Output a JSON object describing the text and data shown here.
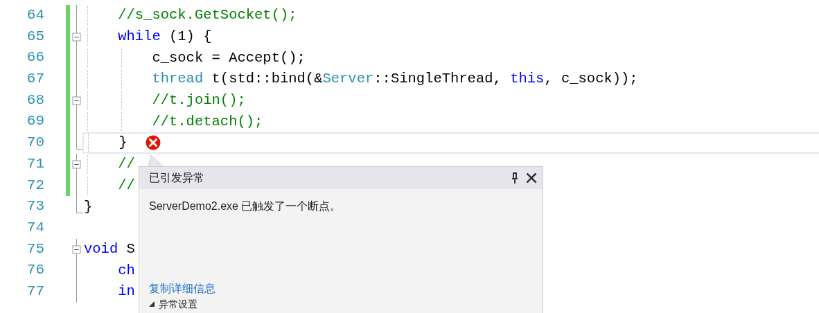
{
  "editor": {
    "lines": [
      {
        "number": "64",
        "kind": "body",
        "changed": true,
        "current": false,
        "error": false,
        "tokens": [
          {
            "kind": "comment",
            "text": "    //s_sock.GetSocket();"
          }
        ]
      },
      {
        "number": "65",
        "kind": "start",
        "changed": true,
        "current": false,
        "error": false,
        "tokens": [
          {
            "kind": "keyword",
            "text": "    while"
          },
          {
            "kind": "plain",
            "text": " (1) {"
          }
        ]
      },
      {
        "number": "66",
        "kind": "body",
        "changed": true,
        "current": false,
        "error": false,
        "tokens": [
          {
            "kind": "plain",
            "text": "        c_sock = Accept();"
          }
        ]
      },
      {
        "number": "67",
        "kind": "body",
        "changed": true,
        "current": false,
        "error": false,
        "tokens": [
          {
            "kind": "type",
            "text": "        thread"
          },
          {
            "kind": "plain",
            "text": " t(std::bind(&"
          },
          {
            "kind": "type",
            "text": "Server"
          },
          {
            "kind": "plain",
            "text": "::SingleThread, "
          },
          {
            "kind": "keyword",
            "text": "this"
          },
          {
            "kind": "plain",
            "text": ", c_sock));"
          }
        ]
      },
      {
        "number": "68",
        "kind": "start",
        "changed": true,
        "current": false,
        "error": false,
        "tokens": [
          {
            "kind": "comment",
            "text": "        //t.join();"
          }
        ]
      },
      {
        "number": "69",
        "kind": "body",
        "changed": true,
        "current": false,
        "error": false,
        "tokens": [
          {
            "kind": "comment",
            "text": "        //t.detach();"
          }
        ]
      },
      {
        "number": "70",
        "kind": "end",
        "changed": true,
        "current": true,
        "error": true,
        "tokens": [
          {
            "kind": "plain",
            "text": "    }"
          }
        ]
      },
      {
        "number": "71",
        "kind": "start",
        "changed": true,
        "current": false,
        "error": false,
        "tokens": [
          {
            "kind": "comment",
            "text": "    //"
          }
        ]
      },
      {
        "number": "72",
        "kind": "body",
        "changed": true,
        "current": false,
        "error": false,
        "tokens": [
          {
            "kind": "comment",
            "text": "    //"
          }
        ]
      },
      {
        "number": "73",
        "kind": "end",
        "changed": false,
        "current": false,
        "error": false,
        "tokens": [
          {
            "kind": "plain",
            "text": "}"
          }
        ]
      },
      {
        "number": "74",
        "kind": "blank",
        "changed": false,
        "current": false,
        "error": false
      },
      {
        "number": "75",
        "kind": "start",
        "changed": false,
        "current": false,
        "error": false,
        "tokens": [
          {
            "kind": "keyword",
            "text": "void"
          },
          {
            "kind": "plain",
            "text": " S"
          }
        ]
      },
      {
        "number": "76",
        "kind": "body",
        "changed": false,
        "current": false,
        "error": false,
        "tokens": [
          {
            "kind": "keyword",
            "text": "    ch"
          }
        ]
      },
      {
        "number": "77",
        "kind": "body",
        "changed": false,
        "current": false,
        "error": false,
        "tokens": [
          {
            "kind": "keyword",
            "text": "    in"
          }
        ]
      }
    ]
  },
  "exception_popup": {
    "title": "已引发异常",
    "message": "ServerDemo2.exe 已触发了一个断点。",
    "link": "复制详细信息",
    "section": "异常设置"
  }
}
